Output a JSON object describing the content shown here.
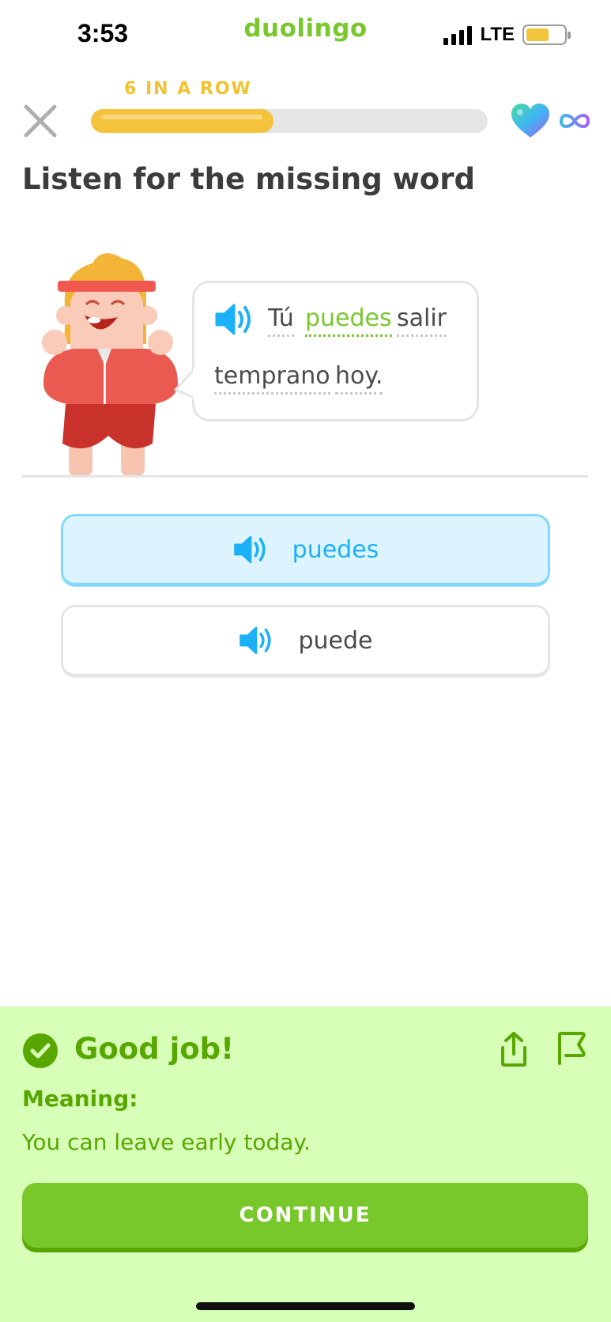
{
  "status_bar": {
    "time": "3:53",
    "brand": "duolingo",
    "network": "LTE",
    "battery_level": 0.6
  },
  "lesson": {
    "streak_label": "6 IN A ROW",
    "progress": 0.46,
    "hearts": "infinite",
    "title": "Listen for the missing word"
  },
  "sentence": {
    "words": [
      "Tú",
      "puedes",
      "salir",
      "temprano",
      "hoy."
    ],
    "highlighted_word": "puedes"
  },
  "options": [
    {
      "label": "puedes",
      "selected": true
    },
    {
      "label": "puede",
      "selected": false
    }
  ],
  "feedback": {
    "heading": "Good job!",
    "meaning_label": "Meaning:",
    "meaning_text": "You can leave early today.",
    "continue_label": "CONTINUE"
  },
  "icons": {
    "close": "close-icon",
    "heart": "heart-icon",
    "infinity": "infinity-icon",
    "speaker": "speaker-icon",
    "check": "check-circle-icon",
    "share": "share-icon",
    "flag": "flag-icon"
  },
  "colors": {
    "brand_green": "#78c72b",
    "feedback_green": "#58a700",
    "feedback_bg": "#d7ffb8",
    "streak_yellow": "#f2c230",
    "selected_blue": "#1cb0f6",
    "selected_bg": "#ddf4ff"
  }
}
